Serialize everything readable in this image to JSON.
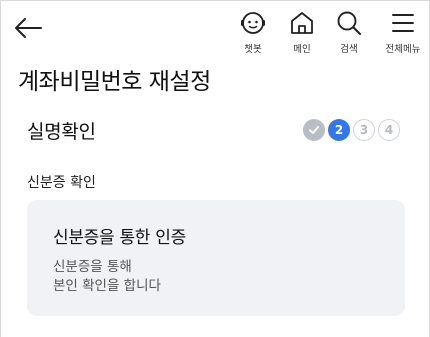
{
  "header": {
    "nav": [
      {
        "icon": "chatbot-icon",
        "label": "챗봇"
      },
      {
        "icon": "home-icon",
        "label": "메인"
      },
      {
        "icon": "search-icon",
        "label": "검색"
      },
      {
        "icon": "menu-icon",
        "label": "전체메뉴"
      }
    ]
  },
  "page": {
    "title": "계좌비밀번호 재설정"
  },
  "section": {
    "title": "실명확인",
    "steps": [
      {
        "label": "✓",
        "state": "done"
      },
      {
        "label": "2",
        "state": "current"
      },
      {
        "label": "3",
        "state": "todo"
      },
      {
        "label": "4",
        "state": "todo"
      }
    ],
    "sub_label": "신분증 확인"
  },
  "card": {
    "title": "신분증을 통한 인증",
    "desc_line1": "신분증을 통해",
    "desc_line2": "본인 확인을 합니다"
  },
  "colors": {
    "accent": "#3478e5",
    "card_bg": "#f0f2f5",
    "step_done": "#b9bec6"
  }
}
